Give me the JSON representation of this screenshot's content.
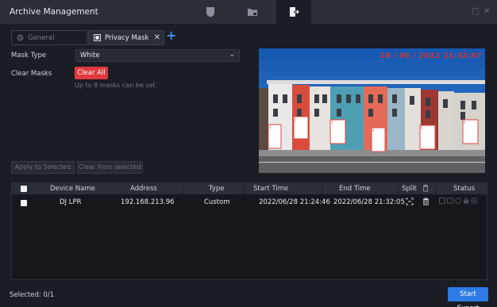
{
  "window": {
    "title": "Archive Management",
    "tabs": [
      {
        "icon": "shield-icon",
        "active": false
      },
      {
        "icon": "folder-icon",
        "active": false
      },
      {
        "icon": "export-icon",
        "active": true
      }
    ]
  },
  "sub_tabs": {
    "general": "General",
    "privacy_mask": "Privacy Mask"
  },
  "form": {
    "mask_type_label": "Mask Type",
    "mask_type_value": "White",
    "clear_masks_label": "Clear Masks",
    "clear_all_button": "Clear All",
    "hint": "Up to 8 masks can be set."
  },
  "preview": {
    "timestamp": "28 / 06 / 2022  21:32:07"
  },
  "actions": {
    "apply_to_selected": "Apply to Selected",
    "clear_from_selected": "Clear from selected"
  },
  "table": {
    "headers": {
      "device_name": "Device Name",
      "address": "Address",
      "type": "Type",
      "start_time": "Start Time",
      "end_time": "End Time",
      "split": "Split",
      "status": "Status"
    },
    "rows": [
      {
        "device_name": "DJ LPR",
        "address": "192.168.213.96",
        "type": "Custom",
        "start_time": "2022/06/28 21:24:46",
        "end_time": "2022/06/28 21:32:05"
      }
    ]
  },
  "footer": {
    "selected": "Selected: 0/1",
    "start_export": "Start Export"
  },
  "colors": {
    "accent": "#2f7be6",
    "danger": "#e0393e",
    "background": "#1a1d23",
    "titlebar": "#2a2e36"
  }
}
